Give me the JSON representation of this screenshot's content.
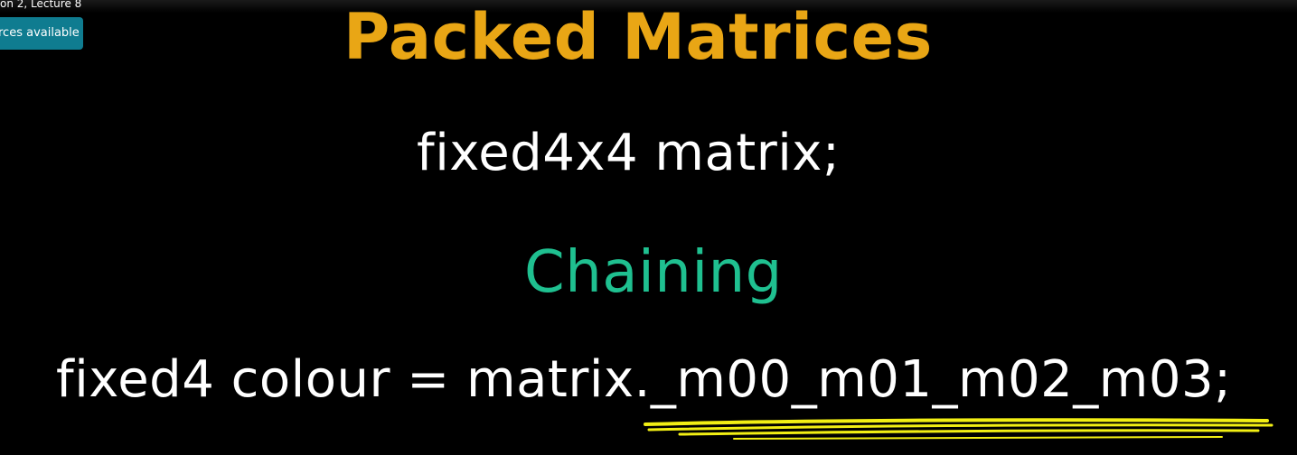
{
  "header": {
    "lecture_label": "on 2, Lecture 8",
    "resources_button": "rces available"
  },
  "slide": {
    "title": "Packed Matrices",
    "declaration": "fixed4x4 matrix;",
    "subheading": "Chaining",
    "chaining_code": "fixed4 colour = matrix._m00_m01_m02_m03;"
  },
  "colors": {
    "background": "#000000",
    "title": "#e9a615",
    "subheading": "#1fc090",
    "text": "#ffffff",
    "highlight": "#f2ef14",
    "button": "#0f7c90"
  }
}
